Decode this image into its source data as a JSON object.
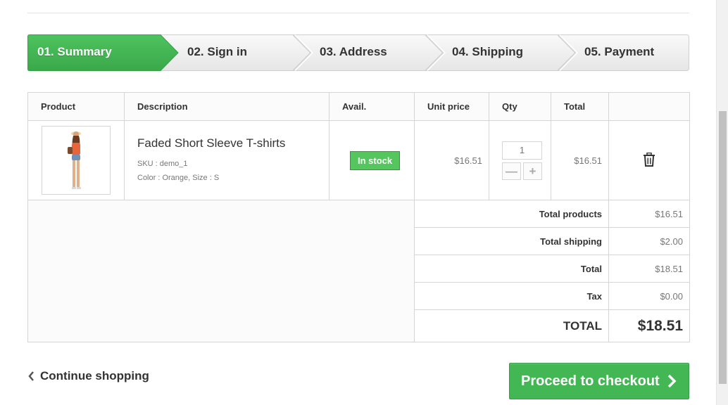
{
  "steps": [
    {
      "label": "01. Summary",
      "active": true
    },
    {
      "label": "02. Sign in",
      "active": false
    },
    {
      "label": "03. Address",
      "active": false
    },
    {
      "label": "04. Shipping",
      "active": false
    },
    {
      "label": "05. Payment",
      "active": false
    }
  ],
  "table": {
    "headers": {
      "product": "Product",
      "description": "Description",
      "avail": "Avail.",
      "unit_price": "Unit price",
      "qty": "Qty",
      "total": "Total"
    },
    "item": {
      "name": "Faded Short Sleeve T-shirts",
      "sku": "SKU : demo_1",
      "attributes": "Color : Orange, Size : S",
      "availability": "In stock",
      "unit_price": "$16.51",
      "quantity": "1",
      "total": "$16.51",
      "delete_icon": "trash-icon"
    }
  },
  "summary": {
    "total_products_label": "Total products",
    "total_products_value": "$16.51",
    "total_shipping_label": "Total shipping",
    "total_shipping_value": "$2.00",
    "total_label": "Total",
    "total_value": "$18.51",
    "tax_label": "Tax",
    "tax_value": "$0.00",
    "grand_total_label": "TOTAL",
    "grand_total_value": "$18.51"
  },
  "actions": {
    "continue_label": "Continue shopping",
    "checkout_label": "Proceed to checkout"
  },
  "colors": {
    "step_active": "#43b754",
    "in_stock": "#55c65e",
    "checkout": "#43b754"
  }
}
